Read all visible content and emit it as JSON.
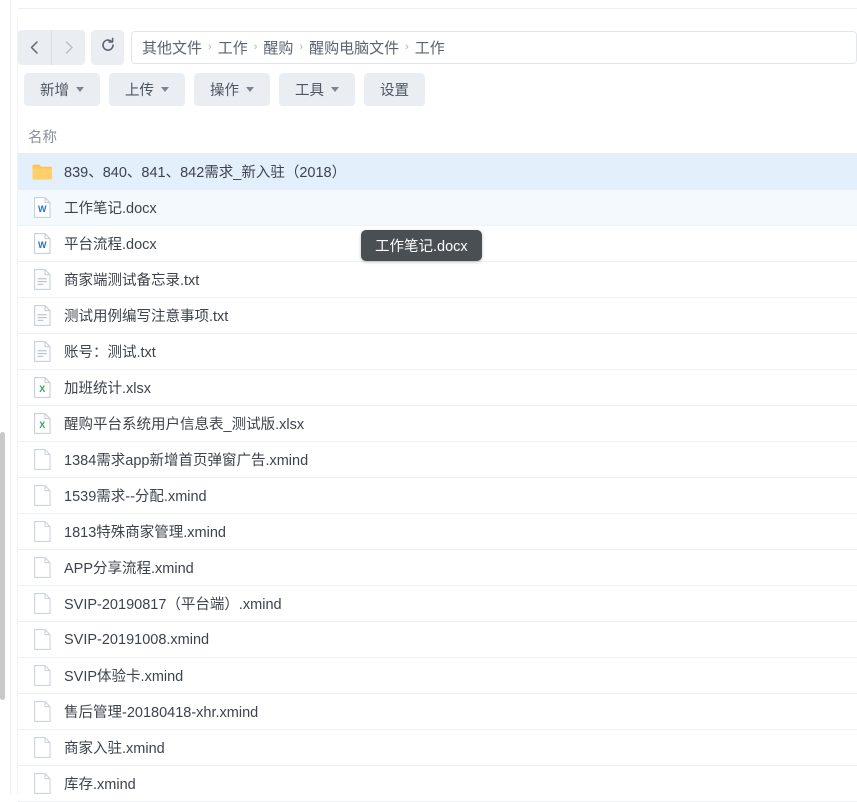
{
  "nav": {
    "back_icon": "chevron-left-icon",
    "forward_icon": "chevron-right-icon",
    "refresh_icon": "refresh-icon",
    "breadcrumb_separator": "›",
    "breadcrumb": [
      "其他文件",
      "工作",
      "醒购",
      "醒购电脑文件",
      "工作"
    ]
  },
  "toolbar": {
    "buttons": [
      {
        "label": "新增",
        "has_caret": true
      },
      {
        "label": "上传",
        "has_caret": true
      },
      {
        "label": "操作",
        "has_caret": true
      },
      {
        "label": "工具",
        "has_caret": true
      },
      {
        "label": "设置",
        "has_caret": false
      }
    ]
  },
  "list": {
    "columns": {
      "name": "名称"
    },
    "rows": [
      {
        "name": "839、840、841、842需求_新入驻（2018）",
        "icon": "folder-icon",
        "state": "selected"
      },
      {
        "name": "工作笔记.docx",
        "icon": "word-file-icon",
        "state": "hover"
      },
      {
        "name": "平台流程.docx",
        "icon": "word-file-icon",
        "state": "normal"
      },
      {
        "name": "商家端测试备忘录.txt",
        "icon": "text-file-icon",
        "state": "normal"
      },
      {
        "name": "测试用例编写注意事项.txt",
        "icon": "text-file-icon",
        "state": "normal"
      },
      {
        "name": "账号：测试.txt",
        "icon": "text-file-icon",
        "state": "normal"
      },
      {
        "name": "加班统计.xlsx",
        "icon": "excel-file-icon",
        "state": "normal"
      },
      {
        "name": "醒购平台系统用户信息表_测试版.xlsx",
        "icon": "excel-file-icon",
        "state": "normal"
      },
      {
        "name": "1384需求app新增首页弹窗广告.xmind",
        "icon": "blank-file-icon",
        "state": "normal"
      },
      {
        "name": "1539需求--分配.xmind",
        "icon": "blank-file-icon",
        "state": "normal"
      },
      {
        "name": "1813特殊商家管理.xmind",
        "icon": "blank-file-icon",
        "state": "normal"
      },
      {
        "name": "APP分享流程.xmind",
        "icon": "blank-file-icon",
        "state": "normal"
      },
      {
        "name": "SVIP-20190817（平台端）.xmind",
        "icon": "blank-file-icon",
        "state": "normal"
      },
      {
        "name": "SVIP-20191008.xmind",
        "icon": "blank-file-icon",
        "state": "normal"
      },
      {
        "name": "SVIP体验卡.xmind",
        "icon": "blank-file-icon",
        "state": "normal"
      },
      {
        "name": "售后管理-20180418-xhr.xmind",
        "icon": "blank-file-icon",
        "state": "normal"
      },
      {
        "name": "商家入驻.xmind",
        "icon": "blank-file-icon",
        "state": "normal"
      },
      {
        "name": "库存.xmind",
        "icon": "blank-file-icon",
        "state": "normal"
      }
    ]
  },
  "tooltip": {
    "text": "工作笔记.docx"
  },
  "colors": {
    "selected_row": "#e3effb",
    "hover_row": "#f4f9fd",
    "toolbar_button": "#eaeef3",
    "folder": "#fcc558",
    "word_blue": "#2b6fd6",
    "excel_green": "#33a457",
    "tooltip_bg": "#4a4f54"
  }
}
